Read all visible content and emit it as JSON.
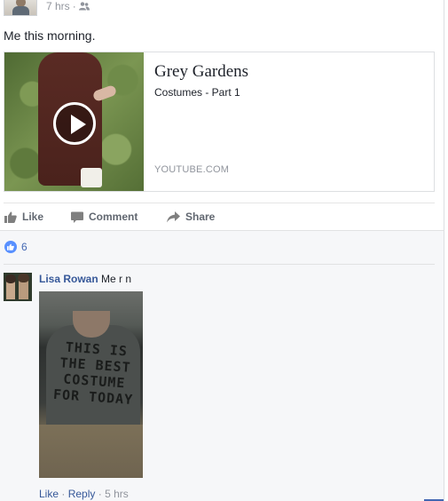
{
  "post": {
    "time": "7 hrs",
    "separator": "·",
    "audience_icon": "friends-icon",
    "text": "Me this morning."
  },
  "link_card": {
    "title": "Grey Gardens",
    "subtitle": "Costumes - Part 1",
    "domain": "YOUTUBE.COM",
    "play_icon": "play-icon"
  },
  "actions": {
    "like": "Like",
    "comment": "Comment",
    "share": "Share"
  },
  "reactions": {
    "count": "6",
    "icon": "like-icon",
    "color": "#5890ff"
  },
  "comment": {
    "author": "Lisa Rowan",
    "text": "Me r n",
    "photo_text_lines": [
      "THIS IS",
      "THE BEST",
      "COSTUME",
      "FOR TODAY"
    ],
    "like": "Like",
    "reply": "Reply",
    "separator": "·",
    "time": "5 hrs"
  },
  "colors": {
    "link": "#365899",
    "muted": "#90949c",
    "action": "#616770"
  }
}
